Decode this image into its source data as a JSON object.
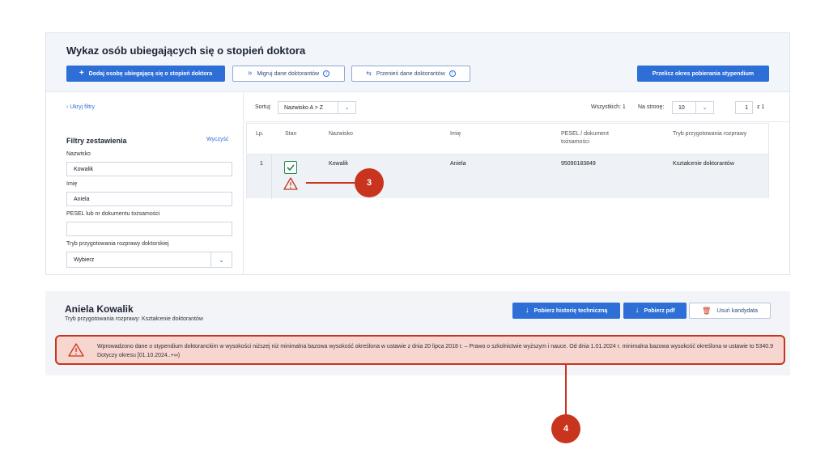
{
  "top_panel": {
    "title": "Wykaz osób ubiegających się o stopień doktora",
    "buttons": {
      "add": "Dodaj osobę ubiegającą się o stopień doktora",
      "migrate": "Migruj dane doktorantów",
      "transfer": "Przenieś dane doktorantów",
      "recalc": "Przelicz okres pobierania stypendium"
    }
  },
  "filters": {
    "hide_label": "Ukryj filtry",
    "title": "Filtry zestawienia",
    "clear": "Wyczyść",
    "fields": [
      {
        "label": "Nazwisko",
        "value": "Kowalik"
      },
      {
        "label": "Imię",
        "value": "Aniela"
      },
      {
        "label": "PESEL lub nr dokumentu tożsamości",
        "value": ""
      },
      {
        "label": "Tryb przygotowania rozprawy doktorskiej",
        "value": "Wybierz"
      }
    ]
  },
  "toolbar": {
    "sort_label": "Sortuj:",
    "sort_value": "Nazwisko A > Z",
    "total_label": "Wszystkich: 1",
    "per_page_label": "Na stronę:",
    "per_page_value": "10",
    "page": "1",
    "page_of": "z 1"
  },
  "table": {
    "headers": [
      "Lp.",
      "Stan",
      "Nazwisko",
      "Imię",
      "PESEL / dokument tożsamości",
      "Tryb przygotowania rozprawy"
    ],
    "rows": [
      {
        "lp": "1",
        "nazwisko": "Kowalik",
        "imie": "Aniela",
        "pesel": "95090183849",
        "tryb": "Kształcenie doktorantów"
      }
    ]
  },
  "callouts": {
    "c3": "3",
    "c4": "4"
  },
  "detail": {
    "name": "Aniela Kowalik",
    "subtitle": "Tryb przygotowania rozprawy: Kształcenie doktorantów",
    "buttons": {
      "history": "Pobierz historię techniczną",
      "pdf": "Pobierz pdf",
      "delete": "Usuń kandydata"
    },
    "alert": "Wprowadzono dane o stypendium doktoranckim w wysokości niższej niż minimalna bazowa wysokość określona w ustawie z dnia 20 lipca 2018 r. – Prawo o szkolnictwie wyższym i nauce. Od dnia 1.01.2024 r. minimalna bazowa wysokość określona w ustawie to 5340.9 Dotyczy okresu [01.10.2024..+∞)"
  },
  "colors": {
    "primary": "#2d6fd6",
    "callout": "#c8341e",
    "success": "#1f8a4c"
  }
}
